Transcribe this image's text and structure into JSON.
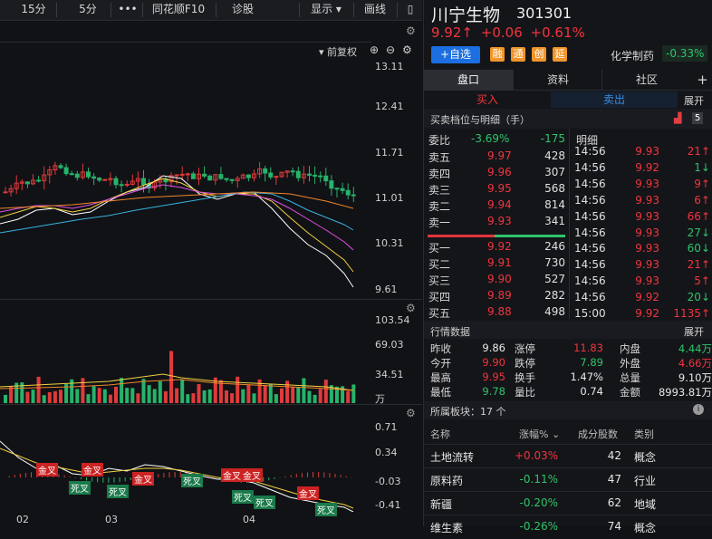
{
  "toolbar": {
    "items": [
      "15分",
      "5分",
      "•••",
      "同花顺F10",
      "诊股",
      "显示",
      "画线"
    ]
  },
  "kline": {
    "fq_label": "前复权",
    "axis": [
      "13.11",
      "12.41",
      "11.71",
      "11.01",
      "10.31",
      "9.61"
    ]
  },
  "volume": {
    "axis": [
      "103.54",
      "69.03",
      "34.51",
      "万"
    ]
  },
  "macd": {
    "axis": [
      "0.71",
      "0.34",
      "-0.03",
      "-0.41"
    ],
    "gold_cross": "金叉",
    "dead_cross": "死叉"
  },
  "x_labels": [
    "02",
    "03",
    "04"
  ],
  "stock": {
    "name": "川宁生物",
    "code": "301301",
    "price": "9.92",
    "arrow": "↑",
    "change": "+0.06",
    "change_pct": "+0.61%",
    "add_watch": "+自选",
    "tags": [
      "融",
      "通",
      "创",
      "延"
    ],
    "sector": "化学制药",
    "sector_pct": "-0.33%"
  },
  "tabs": [
    "盘口",
    "资料",
    "社区"
  ],
  "trade": {
    "buy": "买入",
    "sell": "卖出",
    "expand": "展开"
  },
  "orderbook": {
    "title": "买卖档位与明细（手）",
    "badge": "5",
    "weibi_label": "委比",
    "weibi_pct": "-3.69%",
    "weibi_val": "-175",
    "detail_title": "明细",
    "asks": [
      {
        "label": "卖五",
        "price": "9.97",
        "vol": "428"
      },
      {
        "label": "卖四",
        "price": "9.96",
        "vol": "307"
      },
      {
        "label": "卖三",
        "price": "9.95",
        "vol": "568"
      },
      {
        "label": "卖二",
        "price": "9.94",
        "vol": "814"
      },
      {
        "label": "卖一",
        "price": "9.93",
        "vol": "341"
      }
    ],
    "bids": [
      {
        "label": "买一",
        "price": "9.92",
        "vol": "246"
      },
      {
        "label": "买二",
        "price": "9.91",
        "vol": "730"
      },
      {
        "label": "买三",
        "price": "9.90",
        "vol": "527"
      },
      {
        "label": "买四",
        "price": "9.89",
        "vol": "282"
      },
      {
        "label": "买五",
        "price": "9.88",
        "vol": "498"
      }
    ]
  },
  "detail": [
    {
      "time": "14:56",
      "price": "9.93",
      "vol": "21↑"
    },
    {
      "time": "14:56",
      "price": "9.92",
      "vol": "1↓"
    },
    {
      "time": "14:56",
      "price": "9.93",
      "vol": "9↑"
    },
    {
      "time": "14:56",
      "price": "9.93",
      "vol": "6↑"
    },
    {
      "time": "14:56",
      "price": "9.93",
      "vol": "66↑"
    },
    {
      "time": "14:56",
      "price": "9.93",
      "vol": "27↓"
    },
    {
      "time": "14:56",
      "price": "9.93",
      "vol": "60↓"
    },
    {
      "time": "14:56",
      "price": "9.93",
      "vol": "21↑"
    },
    {
      "time": "14:56",
      "price": "9.93",
      "vol": "5↑"
    },
    {
      "time": "14:56",
      "price": "9.92",
      "vol": "20↓"
    },
    {
      "time": "15:00",
      "price": "9.92",
      "vol": "1135↑"
    }
  ],
  "market": {
    "title": "行情数据",
    "expand": "展开",
    "rows": [
      [
        {
          "l": "昨收",
          "v": "9.86",
          "c": "white"
        },
        {
          "l": "涨停",
          "v": "11.83",
          "c": "red"
        },
        {
          "l": "内盘",
          "v": "4.44万",
          "c": "green"
        }
      ],
      [
        {
          "l": "今开",
          "v": "9.90",
          "c": "red"
        },
        {
          "l": "跌停",
          "v": "7.89",
          "c": "green"
        },
        {
          "l": "外盘",
          "v": "4.66万",
          "c": "red"
        }
      ],
      [
        {
          "l": "最高",
          "v": "9.95",
          "c": "red"
        },
        {
          "l": "换手",
          "v": "1.47%",
          "c": "white"
        },
        {
          "l": "总量",
          "v": "9.10万",
          "c": "white"
        }
      ],
      [
        {
          "l": "最低",
          "v": "9.78",
          "c": "green"
        },
        {
          "l": "量比",
          "v": "0.74",
          "c": "white"
        },
        {
          "l": "金额",
          "v": "8993.81万",
          "c": "white"
        }
      ]
    ]
  },
  "sectors": {
    "title": "所属板块：17 个",
    "headers": [
      "名称",
      "涨幅%",
      "成分股数",
      "类别"
    ],
    "rows": [
      {
        "name": "土地流转",
        "pct": "+0.03%",
        "count": "42",
        "type": "概念",
        "c": "red"
      },
      {
        "name": "原料药",
        "pct": "-0.11%",
        "count": "47",
        "type": "行业",
        "c": "green"
      },
      {
        "name": "新疆",
        "pct": "-0.20%",
        "count": "62",
        "type": "地域",
        "c": "green"
      },
      {
        "name": "维生素",
        "pct": "-0.26%",
        "count": "74",
        "type": "概念",
        "c": "green"
      }
    ]
  }
}
